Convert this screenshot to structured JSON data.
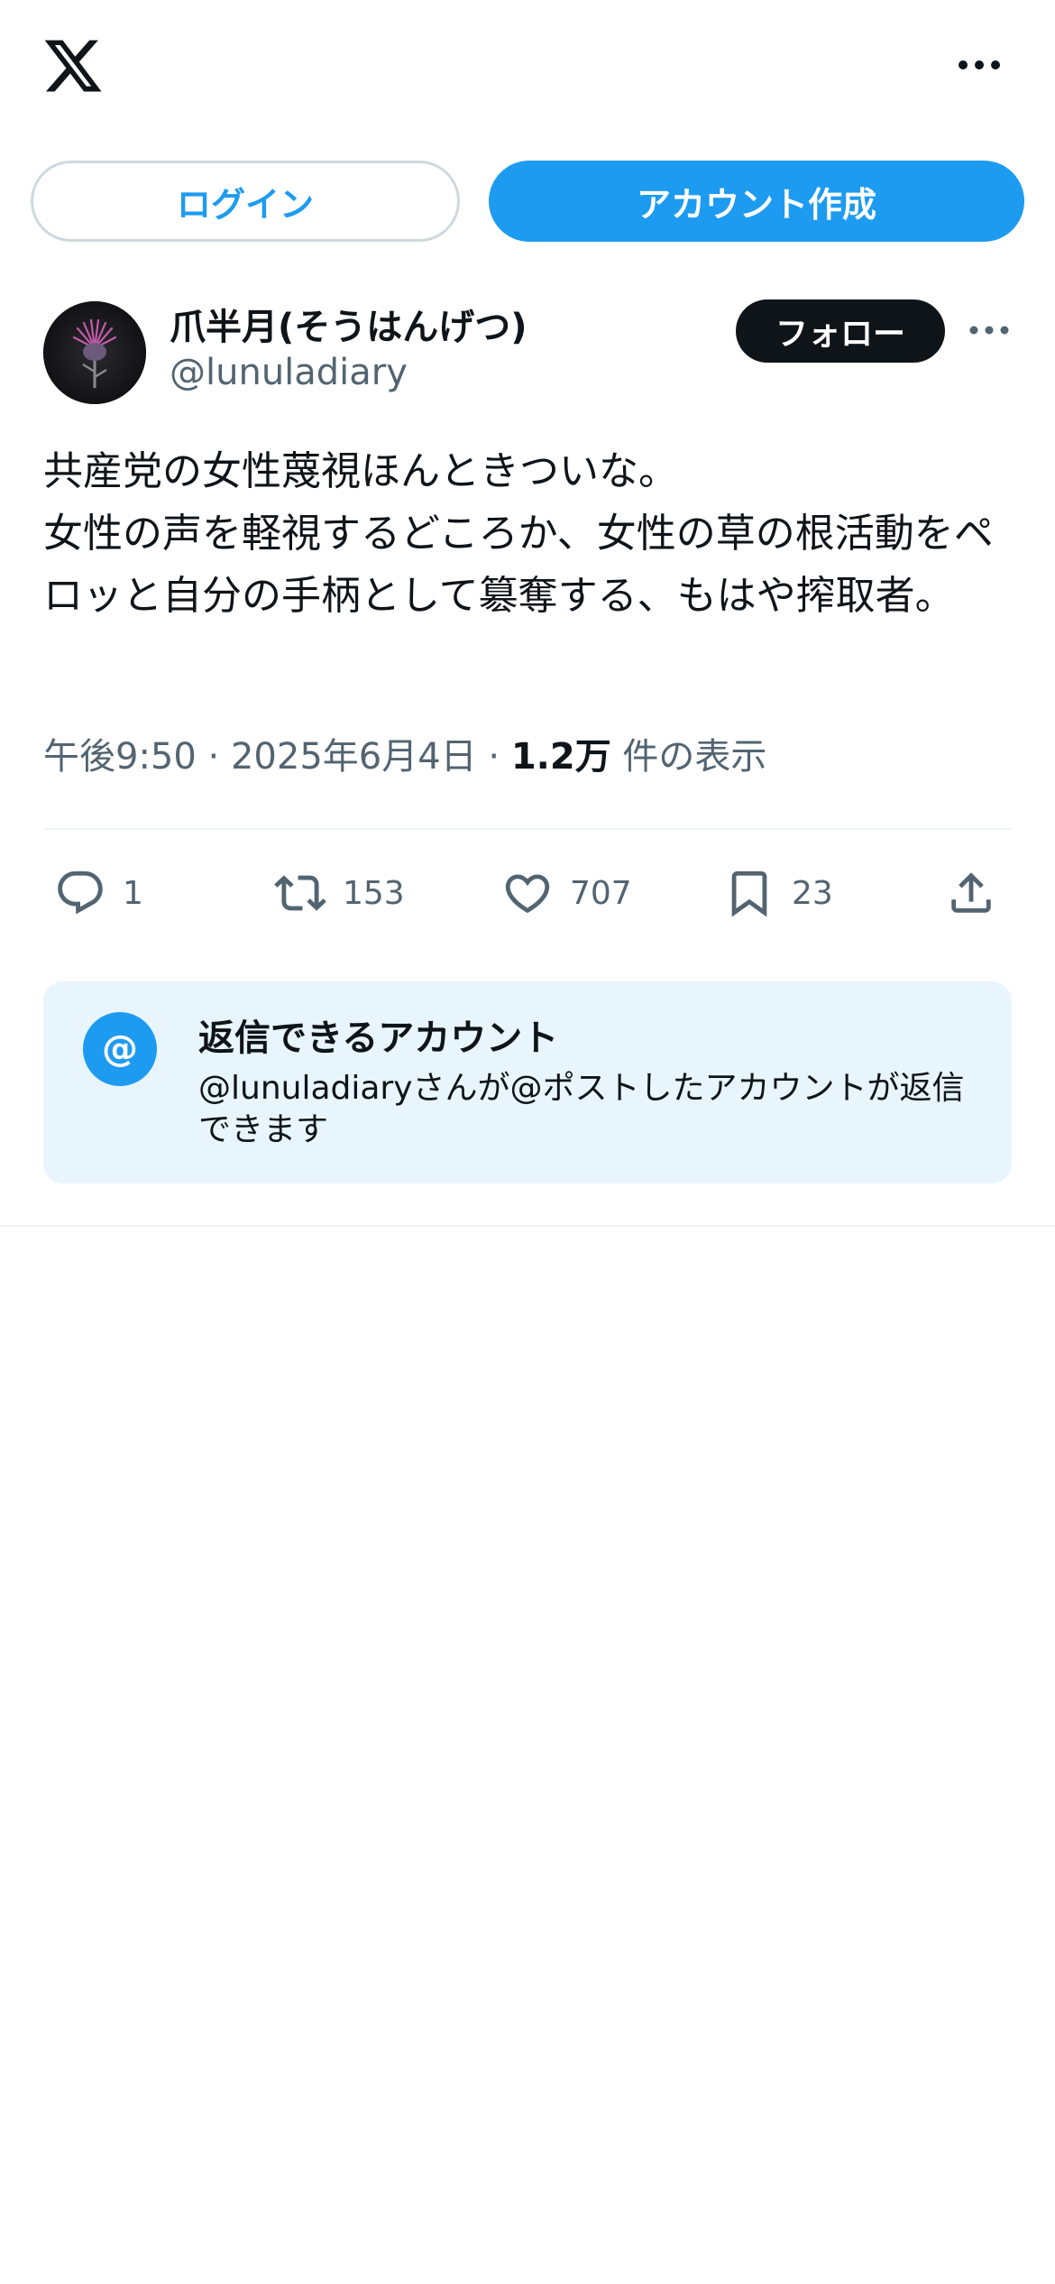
{
  "header": {
    "logo_icon": "x-logo-icon",
    "more_icon": "more-horizontal-icon"
  },
  "auth": {
    "login_label": "ログイン",
    "signup_label": "アカウント作成"
  },
  "post": {
    "author": {
      "name": "爪半月(そうはんげつ)",
      "handle": "@lunuladiary",
      "avatar_icon": "thistle-flower-avatar"
    },
    "follow_label": "フォロー",
    "text": "共産党の女性蔑視ほんときついな。\n女性の声を軽視するどころか、女性の草の根活動をペロッと自分の手柄として簒奪する、もはや搾取者。",
    "time": "午後9:50",
    "separator": "·",
    "date": "2025年6月4日",
    "views_count": "1.2万",
    "views_label": "件の表示",
    "stats": {
      "replies": "1",
      "reposts": "153",
      "likes": "707",
      "bookmarks": "23"
    }
  },
  "reply_restriction": {
    "icon_glyph": "@",
    "title": "返信できるアカウント",
    "description": "@lunuladiaryさんが@ポストしたアカウントが返信できます"
  },
  "colors": {
    "accent": "#1d9bf0",
    "text_primary": "#0f1419",
    "text_secondary": "#536471",
    "border": "#cfd9de",
    "reply_box_bg": "#e8f5fd"
  }
}
